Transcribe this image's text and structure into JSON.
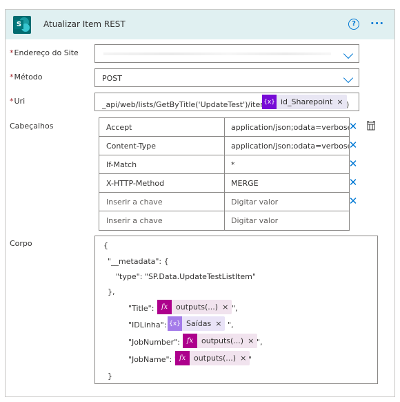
{
  "header": {
    "title": "Atualizar Item REST",
    "help_icon": "help-circle-icon",
    "more_icon": "more-ellipsis-icon",
    "app_icon": "sharepoint-icon",
    "app_icon_letter": "S"
  },
  "fields": {
    "site": {
      "label": "Endereço do Site",
      "required": "*",
      "value": ""
    },
    "method": {
      "label": "Método",
      "required": "*",
      "value": "POST"
    },
    "uri": {
      "label": "Uri",
      "required": "*",
      "value_prefix": "_api/web/lists/GetByTitle('UpdateTest')/items(",
      "value_suffix": ")",
      "token_icon": "{x}",
      "token_label": "id_Sharepoint",
      "token_remove": "×"
    }
  },
  "headers": {
    "label": "Cabeçalhos",
    "rows": [
      {
        "key": "Accept",
        "value": "application/json;odata=verbose"
      },
      {
        "key": "Content-Type",
        "value": "application/json;odata=verbose"
      },
      {
        "key": "If-Match",
        "value": "*"
      },
      {
        "key": "X-HTTP-Method",
        "value": "MERGE"
      },
      {
        "key": "Inserir a chave",
        "value": "Digitar valor"
      },
      {
        "key": "Inserir a chave",
        "value": "Digitar valor"
      }
    ],
    "remove_symbol": "✕"
  },
  "body": {
    "label": "Corpo",
    "lines": [
      "{",
      "\"__metadata\": {",
      "\"type\": \"SP.Data.UpdateTestListItem\"",
      "},"
    ],
    "props": [
      {
        "key": "\"Title\": \"",
        "token_icon": "fx",
        "token_label": "outputs(...)",
        "remove": "×",
        "tail": "\","
      },
      {
        "key": "\"IDLinha\": \"",
        "token_icon": "{x}",
        "token_label": "Saídas",
        "remove": "×",
        "tail": "\","
      },
      {
        "key": "\"JobNumber\": \"",
        "token_icon": "fx",
        "token_label": "outputs(...)",
        "remove": "×",
        "tail": "\","
      },
      {
        "key": "\"JobName\": \"",
        "token_icon": "fx",
        "token_label": "outputs(...)",
        "remove": "×",
        "tail": "\""
      }
    ],
    "closing": "}"
  },
  "colors": {
    "header_bg": "#e0f0f1",
    "accent": "#0078d4",
    "required": "#a4262c",
    "fx_token": "#ad008c",
    "var_token": "#770bd6"
  }
}
